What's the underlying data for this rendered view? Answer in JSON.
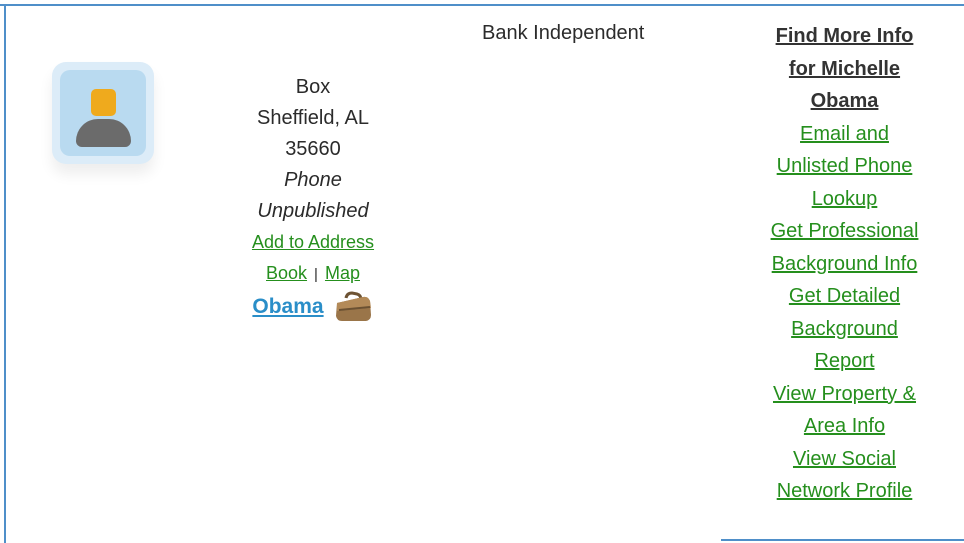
{
  "profile": {
    "address_line_1": "Box",
    "address_line_2": "Sheffield, AL",
    "zip": "35660",
    "phone_label": "Phone",
    "phone_status": "Unpublished",
    "add_to_address_book": {
      "part_1": "Add to Address",
      "part_2": "Book"
    },
    "separator": "|",
    "map": "Map",
    "surname_link": "Obama",
    "avatar_icon": "user-avatar-icon",
    "briefcase_icon": "briefcase-icon"
  },
  "employer": {
    "name": "Bank Independent"
  },
  "more_info": {
    "title": {
      "line_1": "Find More Info",
      "line_2": "for Michelle",
      "line_3": "Obama"
    },
    "links": [
      {
        "line_1": "Email and",
        "line_2": "Unlisted Phone",
        "line_3": "Lookup"
      },
      {
        "line_1": "Get Professional",
        "line_2": "Background Info"
      },
      {
        "line_1": "Get Detailed",
        "line_2": "Background",
        "line_3": "Report"
      },
      {
        "line_1": "View Property &",
        "line_2": "Area Info"
      },
      {
        "line_1": "View Social",
        "line_2": "Network Profile"
      }
    ]
  },
  "colors": {
    "frame": "#4f8fc9",
    "link_green": "#258f1d",
    "link_blue": "#2a8ec8",
    "text": "#2b2b2b"
  }
}
